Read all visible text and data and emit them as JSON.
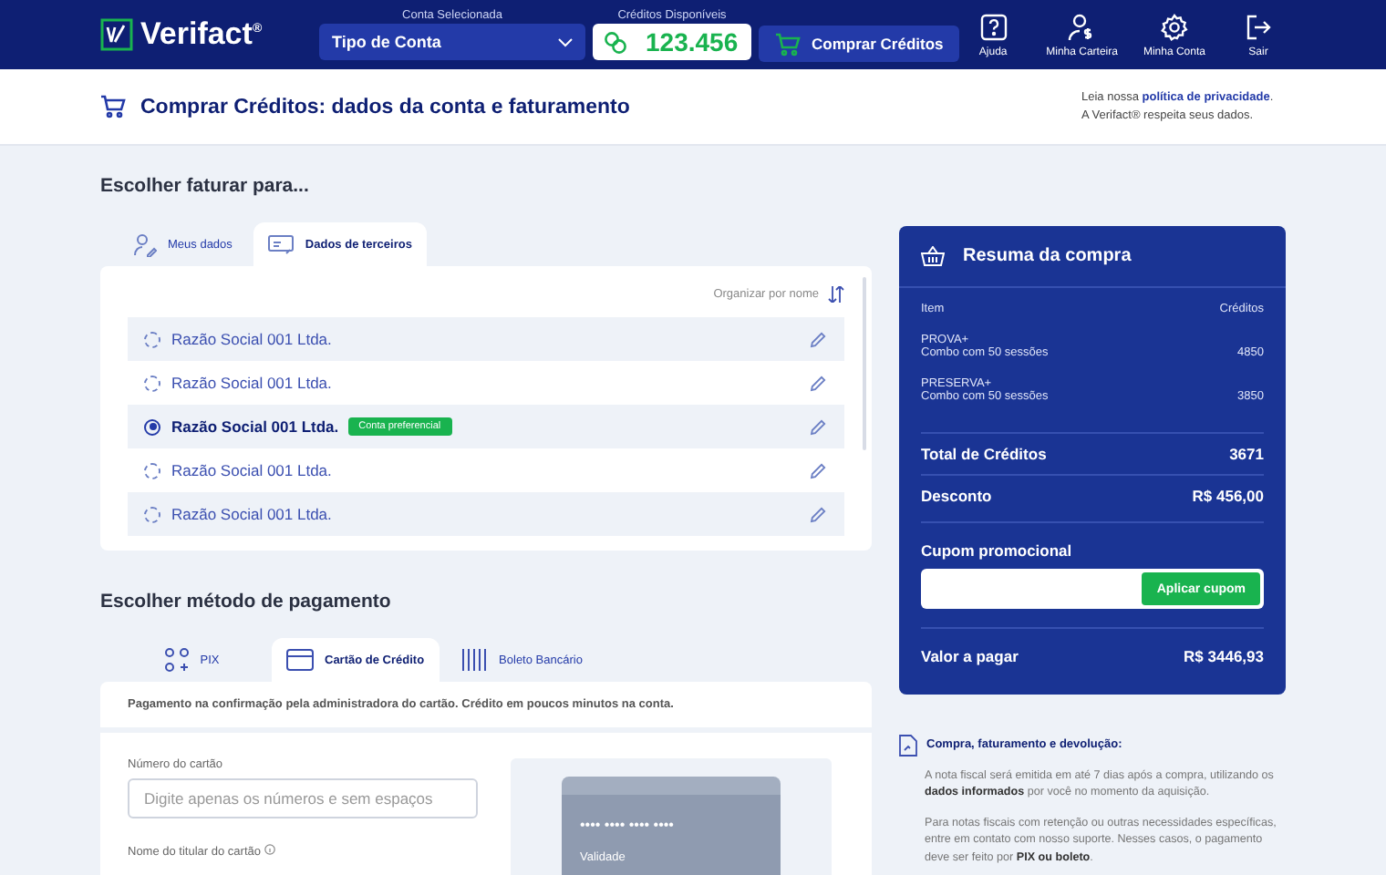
{
  "header": {
    "logo": "Verifact$^{®}$",
    "account_label": "Conta Selecionada",
    "account_value": "Tipo de Conta",
    "credits_label": "Créditos Disponíveis",
    "credits_value": "123.456",
    "buy_button": "Comprar Créditos",
    "nav": [
      {
        "kind": "help",
        "label": "Ajuda"
      },
      {
        "kind": "wallet",
        "label": "Minha Carteira"
      },
      {
        "kind": "settings",
        "label": "Minha Conta"
      },
      {
        "kind": "logout",
        "label": "Sair"
      }
    ]
  },
  "page_title": "Comprar Créditos: dados da conta e faturamento",
  "privacy": {
    "prefix": "Leia nossa",
    "link": "política de privacidade",
    "suffix": ".",
    "line2": "A Verifact® respeita seus dados."
  },
  "billing": {
    "title": "Escolher faturar para...",
    "tabs": [
      {
        "kind": "user",
        "label": "Meus dados",
        "selected": false
      },
      {
        "kind": "third",
        "label": "Dados de terceiros",
        "selected": true
      }
    ],
    "sort_label": "Organizar por nome",
    "entries": [
      {
        "name": "Razão Social 001 Ltda.",
        "selected": false
      },
      {
        "name": "Razão Social 001 Ltda.",
        "selected": false
      },
      {
        "name": "Razão Social 001 Ltda.",
        "selected": true,
        "badge": "Conta preferencial"
      },
      {
        "name": "Razão Social 001 Ltda.",
        "selected": false
      },
      {
        "name": "Razão Social 001 Ltda.",
        "selected": false
      }
    ]
  },
  "payment": {
    "title": "Escolher método de pagamento",
    "tabs": [
      {
        "kind": "pix",
        "label": "PIX",
        "selected": false
      },
      {
        "kind": "card",
        "label": "Cartão de Crédito",
        "selected": true
      },
      {
        "kind": "boleto",
        "label": "Boleto Bancário",
        "selected": false
      }
    ],
    "notice": "Pagamento na confirmação pela administradora do cartão. Crédito em poucos minutos na conta.",
    "card_number_label": "Número do cartão",
    "card_number_placeholder": "Digite apenas os números e sem espaços",
    "holder_label": "Nome do titular do cartão",
    "card_preview": {
      "number": "•••• •••• •••• ••••",
      "expiry_label": "Validade"
    }
  },
  "summary": {
    "title": "Resuma da compra",
    "col_item": "Item",
    "col_credits": "Créditos",
    "items": [
      {
        "name": "PROVA+",
        "detail": "Combo com 50 sessões",
        "credits": "4850"
      },
      {
        "name": "PRESERVA+",
        "detail": "Combo com 50 sessões",
        "credits": "3850"
      }
    ],
    "total_label": "Total de Créditos",
    "total_value": "3671",
    "discount_label": "Desconto",
    "discount_value": "R$ 456,00",
    "coupon_label": "Cupom promocional",
    "coupon_button": "Aplicar cupom",
    "pay_label": "Valor a pagar",
    "pay_value": "R$ 3446,93"
  },
  "info": {
    "title": "Compra, faturamento e devolução:",
    "paragraphs": [
      "A nota fiscal será emitida em até 7 dias após a compra, utilizando os **dados informados** por você no momento da aquisição.",
      "Para notas fiscais com retenção ou outras necessidades específicas, entre em contato com nosso suporte. Nesses casos, o pagamento deve ser feito por **PIX ou boleto**."
    ]
  }
}
